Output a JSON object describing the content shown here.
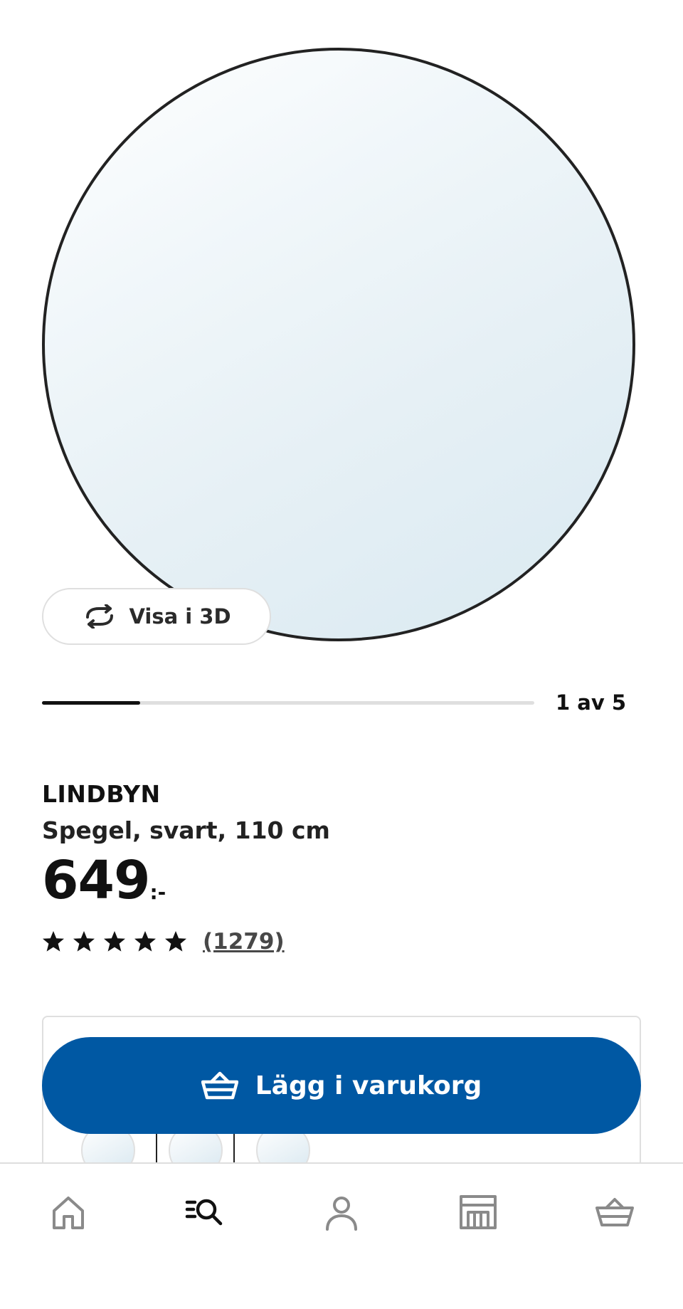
{
  "product_image": {
    "view_3d_label": "Visa i 3D"
  },
  "carousel": {
    "current": 1,
    "total": 5,
    "counter_text": "1 av 5",
    "progress_fraction": 0.2
  },
  "product": {
    "name": "LINDBYN",
    "description": "Spegel, svart, 110 cm",
    "price": "649",
    "price_suffix": ":-",
    "rating_stars": 5,
    "review_count": "(1279)"
  },
  "actions": {
    "add_to_cart_label": "Lägg i varukorg"
  },
  "bottom_nav": {
    "items": [
      {
        "icon": "home-icon"
      },
      {
        "icon": "search-icon",
        "active": true
      },
      {
        "icon": "profile-icon"
      },
      {
        "icon": "store-icon"
      },
      {
        "icon": "cart-icon"
      }
    ]
  },
  "colors": {
    "brand_blue": "#0058a3",
    "text_primary": "#111111",
    "divider": "#dfdfdf",
    "nav_icon_inactive": "#8a8a8a"
  }
}
